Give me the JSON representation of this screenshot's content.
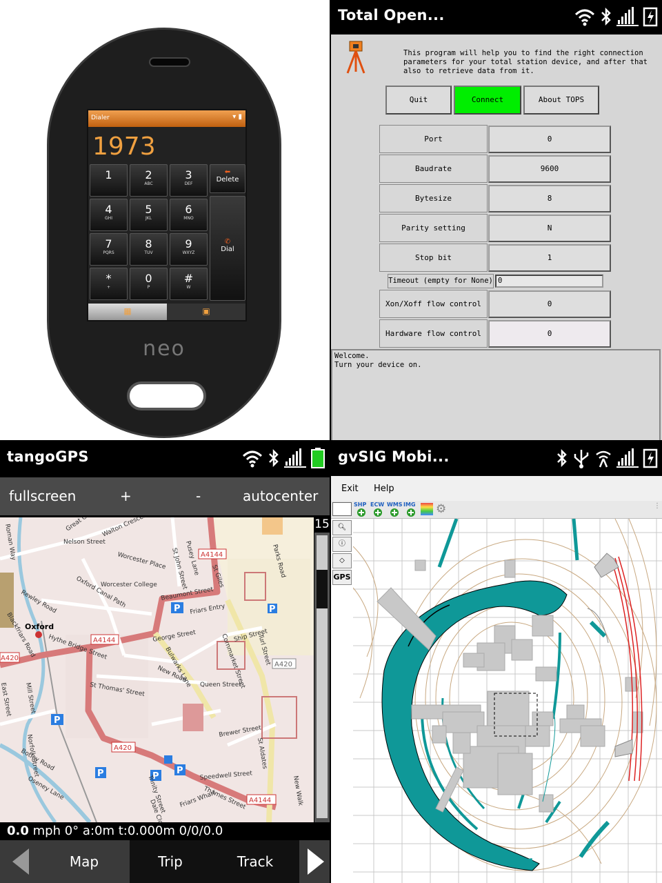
{
  "dialer": {
    "title": "Dialer",
    "number": "1973",
    "keys": [
      {
        "digit": "1",
        "letters": ""
      },
      {
        "digit": "2",
        "letters": "ABC"
      },
      {
        "digit": "3",
        "letters": "DEF"
      },
      {
        "digit": "4",
        "letters": "GHI"
      },
      {
        "digit": "5",
        "letters": "JKL"
      },
      {
        "digit": "6",
        "letters": "MNO"
      },
      {
        "digit": "7",
        "letters": "PQRS"
      },
      {
        "digit": "8",
        "letters": "TUV"
      },
      {
        "digit": "9",
        "letters": "WXYZ"
      },
      {
        "digit": "*",
        "letters": "+"
      },
      {
        "digit": "0",
        "letters": "P"
      },
      {
        "digit": "#",
        "letters": "W"
      }
    ],
    "delete_label": "Delete",
    "dial_label": "Dial",
    "brand": "neo"
  },
  "tops": {
    "title": "Total Open...",
    "intro": "This program will help you to find the right connection parameters for your total station device, and after that also to retrieve data from it.",
    "buttons": {
      "quit": "Quit",
      "connect": "Connect",
      "about": "About TOPS"
    },
    "accent_connect": "#00ee00",
    "rows": [
      {
        "label": "Port",
        "value": "0"
      },
      {
        "label": "Baudrate",
        "value": "9600"
      },
      {
        "label": "Bytesize",
        "value": "8"
      },
      {
        "label": "Parity setting",
        "value": "N"
      },
      {
        "label": "Stop bit",
        "value": "1"
      }
    ],
    "timeout": {
      "label": "Timeout (empty for None)",
      "value": "0"
    },
    "rows2": [
      {
        "label": "Xon/Xoff flow control",
        "value": "0"
      },
      {
        "label": "Hardware flow control",
        "value": "0"
      }
    ],
    "log": [
      "Welcome.",
      "Turn your device on."
    ]
  },
  "tango": {
    "title": "tangoGPS",
    "toolbar": {
      "fullscreen": "fullscreen",
      "zoom_in": "+",
      "zoom_out": "-",
      "autocenter": "autocenter"
    },
    "zoom_level": "15",
    "status": {
      "speed": "0.0",
      "unit": "mph",
      "rest": "0° a:0m  t:0.000m  0/0/0.0"
    },
    "tabs": {
      "map": "Map",
      "trip": "Trip",
      "track": "Track"
    },
    "map_labels": {
      "oxford": "Oxford",
      "a4144_1": "A4144",
      "a4144_2": "A4144",
      "a4144_3": "A4144",
      "a420_1": "A420",
      "a420_2": "A420",
      "a420_3": "A420",
      "beaumont": "Beaumont Street",
      "george": "George Street",
      "queen": "Queen Street",
      "st_thomas": "St Thomas' Street",
      "new_road": "New Road",
      "nelson": "Nelson Street",
      "walton": "Walton Crescent",
      "worcester_college": "Worcester College",
      "worcester_place": "Worcester Place",
      "rewley": "Rewley Road",
      "oxford_canal": "Oxford Canal Path",
      "ship": "Ship Street",
      "turl": "Turl Street",
      "cornmarket": "Cornmarket Street",
      "st_giles": "St Giles",
      "parks": "Parks Road",
      "friars_entry": "Friars Entry",
      "brewer": "Brewer Street",
      "speedwell": "Speedwell Street",
      "thames": "Thames Street",
      "st_aldates": "St Aldates",
      "new_walk": "New Walk",
      "friars_wharf": "Friars Wharf",
      "trinity": "Trinity Street",
      "dale": "Dale Close",
      "mill": "Mill Street",
      "bulwarks": "Bulwarks Lane",
      "st_john": "St John Street",
      "pusey": "Pusey Lane",
      "botley": "Botley Road",
      "oseney": "Oseney Lane",
      "east": "East Street",
      "norfolk": "Norfolk Street",
      "great": "Great Clarendon Street",
      "hythe": "Hythe Bridge Street",
      "roman": "Roman Way",
      "blackfriars": "Blackfriars Road"
    }
  },
  "gvsig": {
    "title": "gvSIG Mobi...",
    "menu": {
      "exit": "Exit",
      "help": "Help"
    },
    "toolbar": [
      "SHP",
      "ECW",
      "WMS",
      "IMG"
    ],
    "side_buttons": {
      "gps": "GPS"
    },
    "colors": {
      "teal": "#0f9898",
      "grey": "#c0c0c0",
      "red": "#dd2222",
      "contour": "#c8a880"
    }
  }
}
